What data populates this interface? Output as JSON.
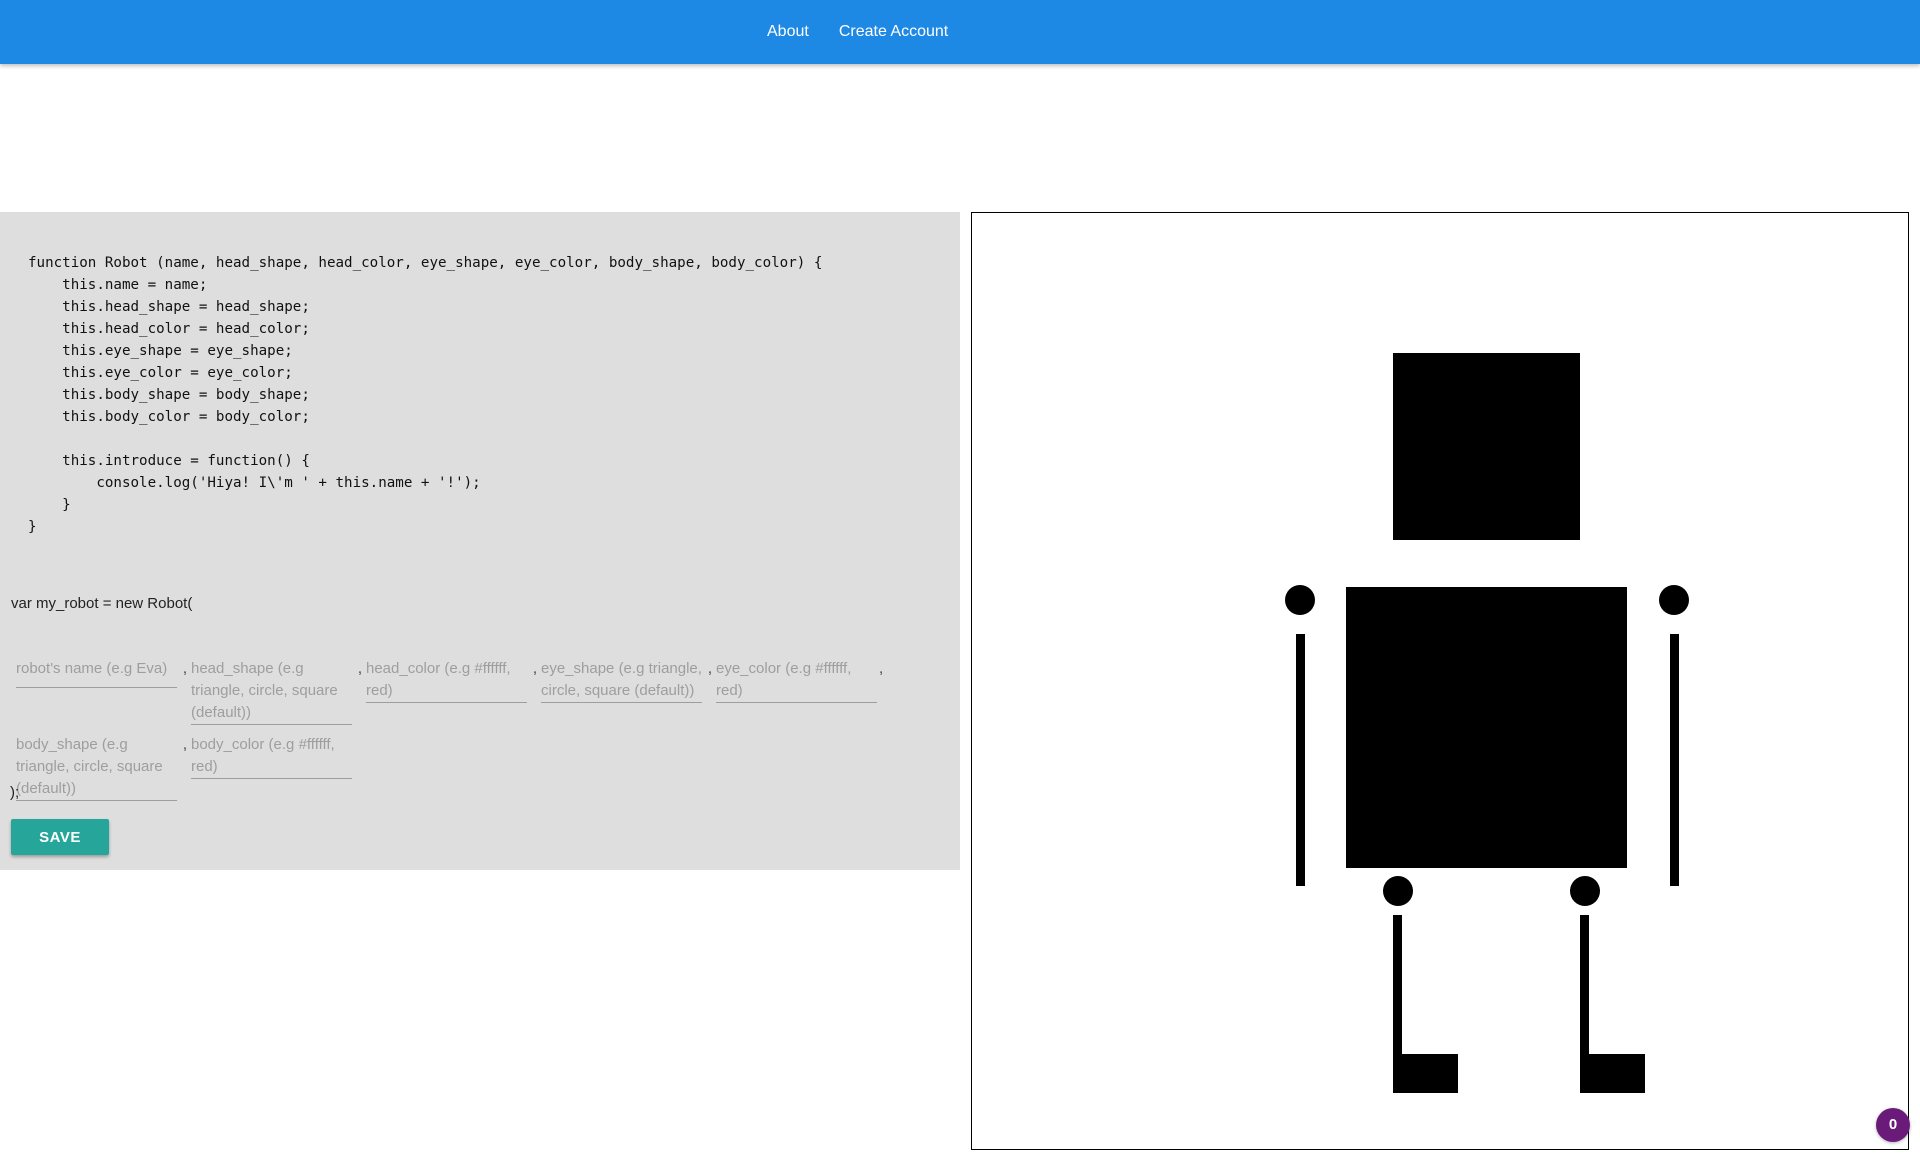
{
  "nav": {
    "links": [
      "About",
      "Create Account"
    ]
  },
  "code": {
    "lines": [
      "function Robot (name, head_shape, head_color, eye_shape, eye_color, body_shape, body_color) {",
      "    this.name = name;",
      "    this.head_shape = head_shape;",
      "    this.head_color = head_color;",
      "    this.eye_shape = eye_shape;",
      "    this.eye_color = eye_color;",
      "    this.body_shape = body_shape;",
      "    this.body_color = body_color;",
      "",
      "    this.introduce = function() {",
      "        console.log('Hiya! I\\'m ' + this.name + '!');",
      "    }",
      "}"
    ]
  },
  "form": {
    "constructor_text": "var my_robot = new Robot(",
    "fields": [
      {
        "name": "name",
        "placeholder": "robot's name (e.g Eva)"
      },
      {
        "name": "head_shape",
        "placeholder": "head_shape (e.g triangle, circle, square (default))"
      },
      {
        "name": "head_color",
        "placeholder": "head_color (e.g #ffffff, red)"
      },
      {
        "name": "eye_shape",
        "placeholder": "eye_shape (e.g triangle, circle, square (default))"
      },
      {
        "name": "eye_color",
        "placeholder": "eye_color (e.g #ffffff, red)"
      },
      {
        "name": "body_shape",
        "placeholder": "body_shape (e.g triangle, circle, square (default))"
      },
      {
        "name": "body_color",
        "placeholder": "body_color (e.g #ffffff, red)"
      }
    ],
    "separator": ",",
    "close_text": ");",
    "save_label": "SAVE"
  },
  "badge": {
    "count": "0"
  },
  "colors": {
    "nav_bg": "#1e88e5",
    "panel_bg": "#dedede",
    "save_bg": "#26a69a",
    "badge_bg": "#6a1b7a",
    "robot_fill": "#000000"
  }
}
